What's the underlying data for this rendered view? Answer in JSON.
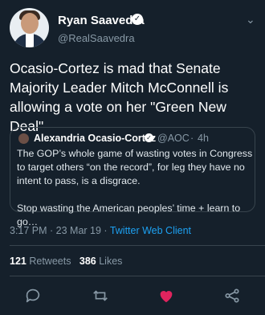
{
  "author": {
    "name": "Ryan Saavedra",
    "handle": "@RealSaavedra"
  },
  "tweet": {
    "text": "Ocasio-Cortez is mad that Senate Majority Leader Mitch McConnell is allowing a vote on her \"Green New Deal\""
  },
  "quoted": {
    "name": "Alexandria Ocasio-Cortez",
    "handle": "@AOC",
    "separator": "·",
    "time": "4h",
    "text": "The GOP’s whole game of wasting votes in Congress to target others “on the record”, for leg they have no intent to pass, is a disgrace.\n\nStop wasting the American peoples’ time + learn to go…"
  },
  "meta": {
    "timestamp": "3:17 PM · 23 Mar 19 · ",
    "client": "Twitter Web Client"
  },
  "stats": {
    "retweets_count": "121",
    "retweets_label": "Retweets",
    "likes_count": "386",
    "likes_label": "Likes"
  },
  "icons": {
    "reply": "comment-icon",
    "retweet": "retweet-icon",
    "like": "heart-icon",
    "share": "share-icon"
  },
  "colors": {
    "background": "#15202b",
    "like_active": "#e0245e",
    "link": "#1da1f2"
  }
}
